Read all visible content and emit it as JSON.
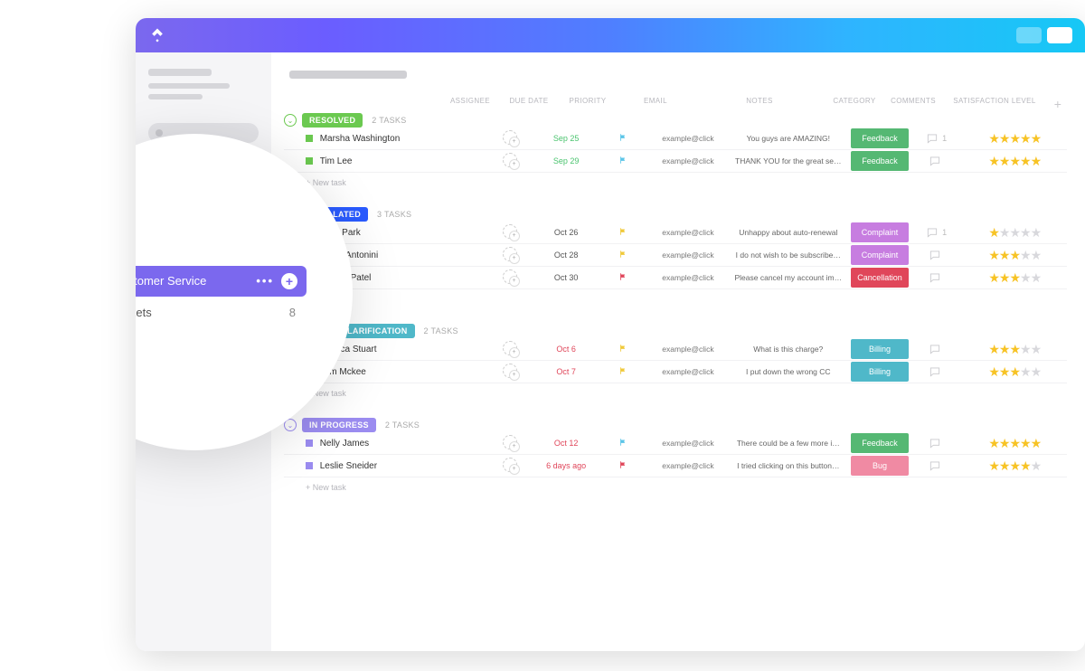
{
  "sidebar_bubble": {
    "folder_label": "Customer Service",
    "list_label": "Tickets",
    "list_count": "8"
  },
  "columns": {
    "assignee": "ASSIGNEE",
    "due": "DUE DATE",
    "priority": "PRIORITY",
    "email": "EMAIL",
    "notes": "NOTES",
    "category": "CATEGORY",
    "comments": "COMMENTS",
    "satisfaction": "SATISFACTION LEVEL"
  },
  "new_task_label": "+ New task",
  "groups": [
    {
      "id": "resolved",
      "label": "RESOLVED",
      "color": "#6bc950",
      "count_label": "2 TASKS",
      "tasks": [
        {
          "name": "Marsha Washington",
          "due": "Sep 25",
          "due_class": "due-green",
          "prio_color": "#5bc5e8",
          "email": "example@click",
          "notes": "You guys are AMAZING!",
          "category": "Feedback",
          "cat_color": "#55b873",
          "comments": "1",
          "stars": 5
        },
        {
          "name": "Tim Lee",
          "due": "Sep 29",
          "due_class": "due-green",
          "prio_color": "#5bc5e8",
          "email": "example@click",
          "notes": "THANK YOU for the great se…",
          "category": "Feedback",
          "cat_color": "#55b873",
          "comments": "",
          "stars": 5
        }
      ]
    },
    {
      "id": "escalated",
      "label": "ESCALATED",
      "color": "#2a5bff",
      "count_label": "3 TASKS",
      "tasks": [
        {
          "name": "Kylie Park",
          "due": "Oct 26",
          "due_class": "due-dark",
          "prio_color": "#f0c93a",
          "email": "example@click",
          "notes": "Unhappy about auto-renewal",
          "category": "Complaint",
          "cat_color": "#c77de0",
          "comments": "1",
          "stars": 1
        },
        {
          "name": "Tessa Antonini",
          "due": "Oct 28",
          "due_class": "due-dark",
          "prio_color": "#f0c93a",
          "email": "example@click",
          "notes": "I do not wish to be subscribe…",
          "category": "Complaint",
          "cat_color": "#c77de0",
          "comments": "",
          "stars": 3
        },
        {
          "name": "Natalie Patel",
          "due": "Oct 30",
          "due_class": "due-dark",
          "prio_color": "#e0465a",
          "email": "example@click",
          "notes": "Please cancel my account im…",
          "category": "Cancellation",
          "cat_color": "#e0465a",
          "comments": "",
          "stars": 3
        }
      ]
    },
    {
      "id": "needs-clarification",
      "label": "NEEDS CLARIFICATION",
      "color": "#4fb8c9",
      "count_label": "2 TASKS",
      "tasks": [
        {
          "name": "Jessica Stuart",
          "due": "Oct 6",
          "due_class": "due-red",
          "prio_color": "#f0c93a",
          "email": "example@click",
          "notes": "What is this charge?",
          "category": "Billing",
          "cat_color": "#4fb8c9",
          "comments": "",
          "stars": 3
        },
        {
          "name": "Tom Mckee",
          "due": "Oct 7",
          "due_class": "due-red",
          "prio_color": "#f0c93a",
          "email": "example@click",
          "notes": "I put down the wrong CC",
          "category": "Billing",
          "cat_color": "#4fb8c9",
          "comments": "",
          "stars": 3
        }
      ]
    },
    {
      "id": "in-progress",
      "label": "IN PROGRESS",
      "color": "#9b8cf0",
      "count_label": "2 TASKS",
      "tasks": [
        {
          "name": "Nelly James",
          "due": "Oct 12",
          "due_class": "due-red",
          "prio_color": "#5bc5e8",
          "email": "example@click",
          "notes": "There could be a few more i…",
          "category": "Feedback",
          "cat_color": "#55b873",
          "comments": "",
          "stars": 5
        },
        {
          "name": "Leslie Sneider",
          "due": "6 days ago",
          "due_class": "due-red",
          "prio_color": "#e0465a",
          "email": "example@click",
          "notes": "I tried clicking on this button…",
          "category": "Bug",
          "cat_color": "#f08aa3",
          "comments": "",
          "stars": 4
        }
      ]
    }
  ]
}
